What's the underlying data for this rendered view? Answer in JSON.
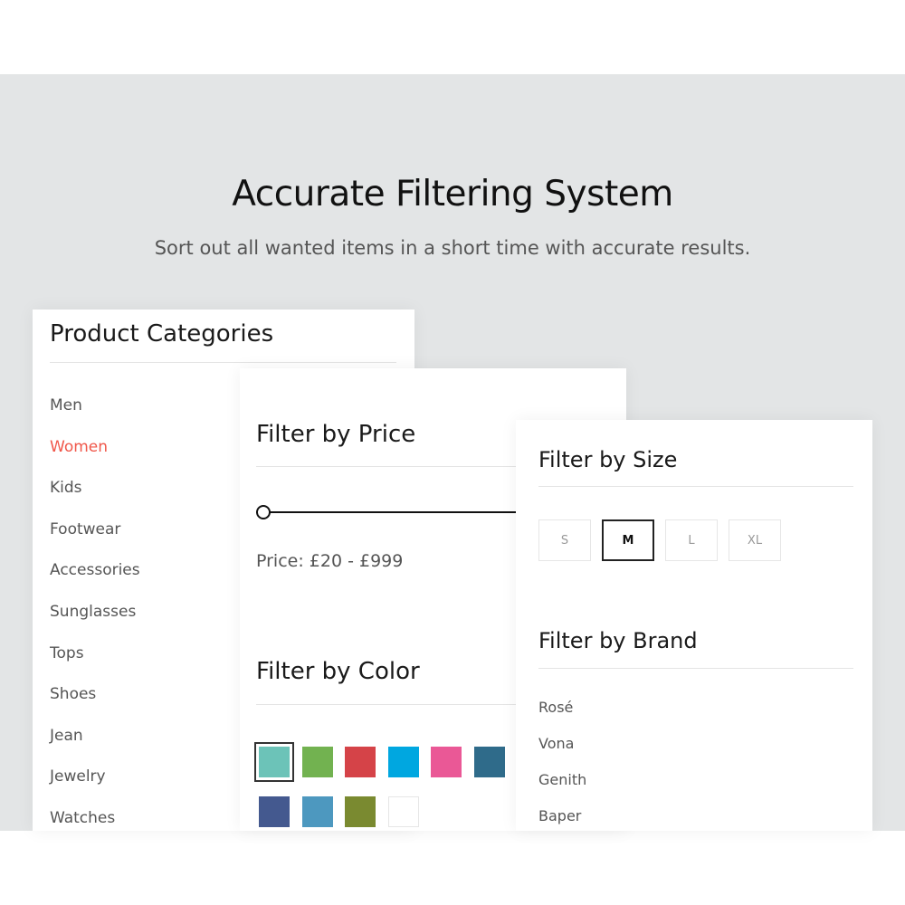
{
  "header": {
    "title": "Accurate Filtering System",
    "subtitle": "Sort out all wanted items in a short time with accurate results."
  },
  "categories": {
    "title": "Product Categories",
    "active_color": "#f0574a",
    "items": [
      {
        "label": "Men",
        "active": false
      },
      {
        "label": "Women",
        "active": true
      },
      {
        "label": "Kids",
        "active": false
      },
      {
        "label": "Footwear",
        "active": false
      },
      {
        "label": "Accessories",
        "active": false
      },
      {
        "label": "Sunglasses",
        "active": false
      },
      {
        "label": "Tops",
        "active": false
      },
      {
        "label": "Shoes",
        "active": false
      },
      {
        "label": "Jean",
        "active": false
      },
      {
        "label": "Jewelry",
        "active": false
      },
      {
        "label": "Watches",
        "active": false
      }
    ]
  },
  "price": {
    "title": "Filter by Price",
    "label": "Price: £20 - £999"
  },
  "color": {
    "title": "Filter by Color",
    "swatches": [
      {
        "color": "#6cc3b8",
        "selected": true
      },
      {
        "color": "#72b250",
        "selected": false
      },
      {
        "color": "#d54348",
        "selected": false
      },
      {
        "color": "#00a7e0",
        "selected": false
      },
      {
        "color": "#ea5896",
        "selected": false
      },
      {
        "color": "#2f6b8a",
        "selected": false
      },
      {
        "color": "#44598f",
        "selected": false
      },
      {
        "color": "#4d98bf",
        "selected": false
      },
      {
        "color": "#7a8a30",
        "selected": false
      },
      {
        "color": "#ffffff",
        "selected": false
      }
    ]
  },
  "size": {
    "title": "Filter by Size",
    "options": [
      {
        "label": "S",
        "selected": false
      },
      {
        "label": "M",
        "selected": true
      },
      {
        "label": "L",
        "selected": false
      },
      {
        "label": "XL",
        "selected": false
      }
    ]
  },
  "brand": {
    "title": "Filter by Brand",
    "items": [
      "Rosé",
      "Vona",
      "Genith",
      "Baper"
    ]
  }
}
